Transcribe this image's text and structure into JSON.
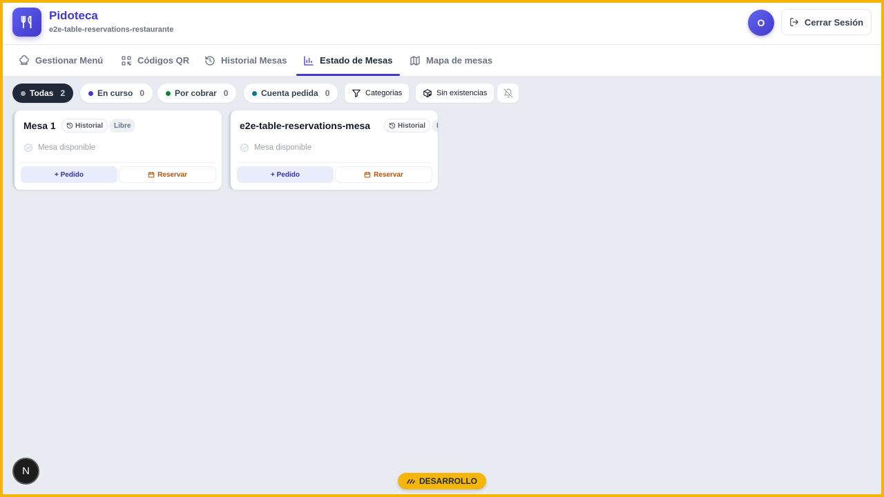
{
  "brand": {
    "title": "Pidoteca",
    "subtitle": "e2e-table-reservations-restaurante",
    "logo_icon": "fork-knife-icon",
    "accent": "#4338ca"
  },
  "user": {
    "avatar_initial": "O",
    "logout_label": "Cerrar Sesión"
  },
  "tabs": [
    {
      "label": "Gestionar Menú",
      "icon": "chef-hat-icon",
      "active": false
    },
    {
      "label": "Códigos QR",
      "icon": "qr-code-icon",
      "active": false
    },
    {
      "label": "Historial Mesas",
      "icon": "history-icon",
      "active": false
    },
    {
      "label": "Estado de Mesas",
      "icon": "bar-chart-icon",
      "active": true
    },
    {
      "label": "Mapa de mesas",
      "icon": "map-icon",
      "active": false
    }
  ],
  "filters": [
    {
      "label": "Todas",
      "count": "2",
      "color": "#9ca3af",
      "selected": true
    },
    {
      "label": "En curso",
      "count": "0",
      "color": "#4338ca"
    },
    {
      "label": "Por cobrar",
      "count": "0",
      "color": "#15803d"
    },
    {
      "label": "Cuenta pedida",
      "count": "0",
      "color": "#0e7490"
    }
  ],
  "tools": {
    "categories_label": "Categorias",
    "out_of_stock_label": "Sin existencias"
  },
  "tables": [
    {
      "name": "Mesa 1",
      "history_label": "Historial",
      "status_label": "Libre",
      "status_text": "Mesa disponible",
      "order_label": "+ Pedido",
      "reserve_label": "Reservar"
    },
    {
      "name": "e2e-table-reservations-mesa",
      "history_label": "Historial",
      "status_label": "Libre",
      "status_text": "Mesa disponible",
      "order_label": "+ Pedido",
      "reserve_label": "Reservar"
    }
  ],
  "dev_badge": "DESARROLLO",
  "next_badge": "N"
}
